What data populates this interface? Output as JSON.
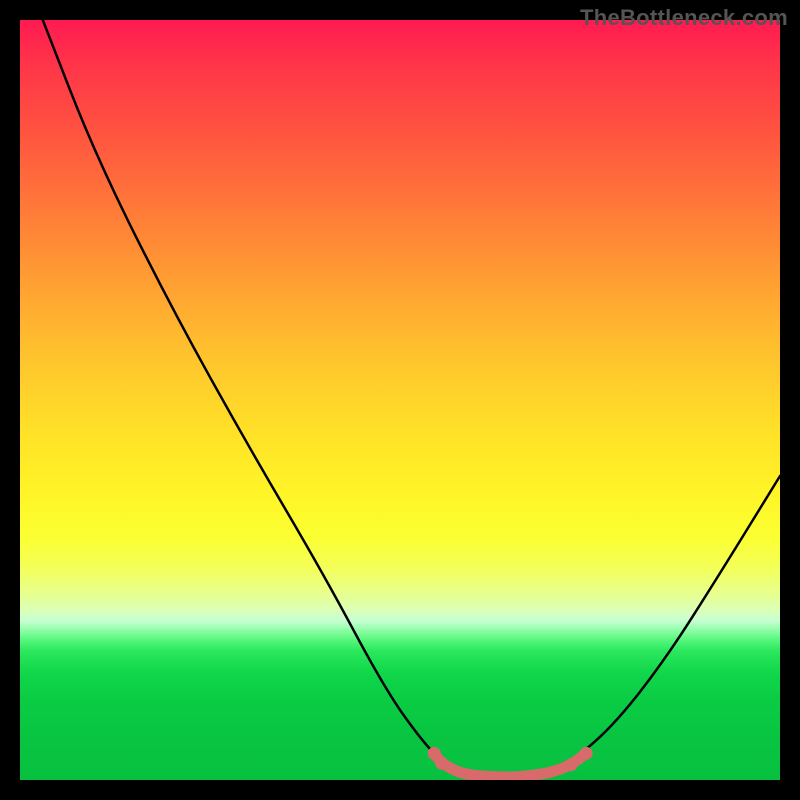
{
  "watermark": "TheBottleneck.com",
  "chart_data": {
    "type": "line",
    "title": "",
    "xlabel": "",
    "ylabel": "",
    "ylim": [
      0,
      100
    ],
    "series": [
      {
        "name": "curve",
        "color": "#000000",
        "points": [
          {
            "x": 0.03,
            "y": 1.0
          },
          {
            "x": 0.1,
            "y": 0.82
          },
          {
            "x": 0.2,
            "y": 0.62
          },
          {
            "x": 0.3,
            "y": 0.44
          },
          {
            "x": 0.4,
            "y": 0.27
          },
          {
            "x": 0.48,
            "y": 0.12
          },
          {
            "x": 0.53,
            "y": 0.05
          },
          {
            "x": 0.56,
            "y": 0.02
          },
          {
            "x": 0.6,
            "y": 0.005
          },
          {
            "x": 0.66,
            "y": 0.005
          },
          {
            "x": 0.72,
            "y": 0.02
          },
          {
            "x": 0.78,
            "y": 0.07
          },
          {
            "x": 0.85,
            "y": 0.16
          },
          {
            "x": 0.92,
            "y": 0.27
          },
          {
            "x": 1.0,
            "y": 0.4
          }
        ]
      },
      {
        "name": "highlight",
        "color": "#e06666",
        "points": [
          {
            "x": 0.545,
            "y": 0.035
          },
          {
            "x": 0.555,
            "y": 0.022
          },
          {
            "x": 0.58,
            "y": 0.008
          },
          {
            "x": 0.62,
            "y": 0.004
          },
          {
            "x": 0.66,
            "y": 0.004
          },
          {
            "x": 0.7,
            "y": 0.01
          },
          {
            "x": 0.725,
            "y": 0.02
          },
          {
            "x": 0.745,
            "y": 0.035
          }
        ]
      }
    ]
  }
}
